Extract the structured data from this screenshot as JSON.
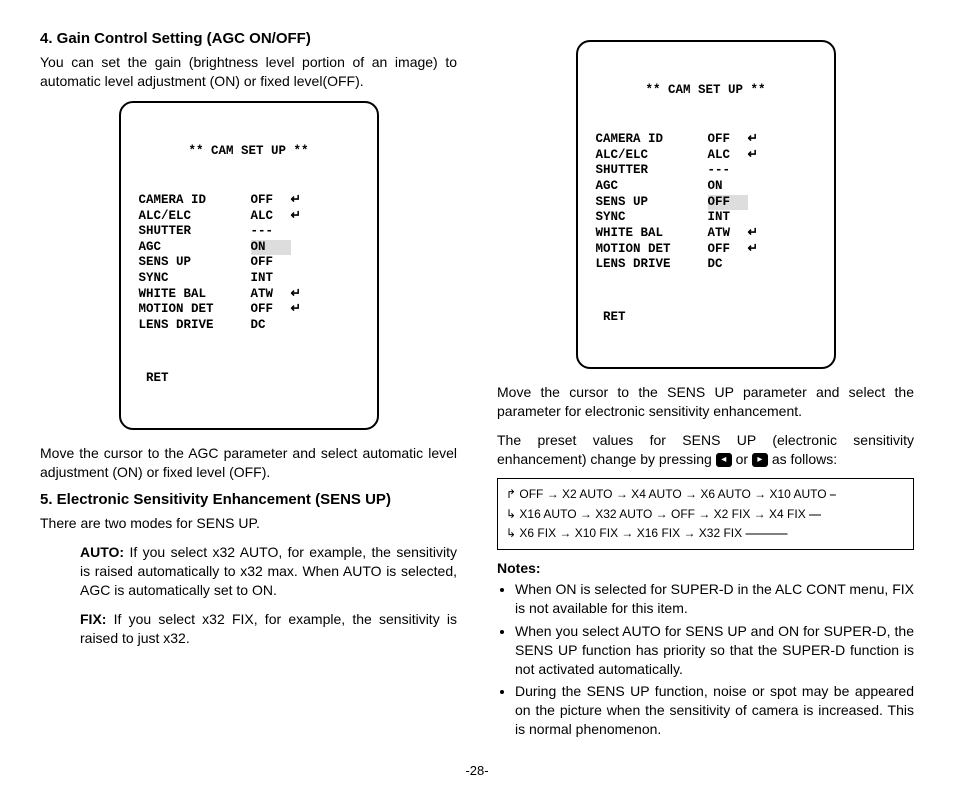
{
  "left": {
    "section4": {
      "heading": "4. Gain Control Setting (AGC ON/OFF)",
      "intro": "You can set the gain (brightness level portion of an image) to automatic level adjustment (ON) or fixed level(OFF).",
      "post": "Move the cursor to the AGC parameter and select automatic level adjustment (ON) or fixed level (OFF)."
    },
    "section5": {
      "heading": "5. Electronic Sensitivity Enhancement (SENS UP)",
      "intro": "There are two modes for SENS UP.",
      "auto_label": "AUTO:",
      "auto_text": "If you select x32 AUTO, for example, the sensitivity is raised automatically to x32 max. When AUTO is selected, AGC is automatically set to ON.",
      "fix_label": "FIX:",
      "fix_text": "If you select x32 FIX, for example, the sensitivity is raised to just x32."
    },
    "menu": {
      "title": "** CAM SET UP **",
      "rows": [
        {
          "label": "CAMERA ID",
          "val": "OFF",
          "mark": "↵"
        },
        {
          "label": "ALC/ELC",
          "val": "ALC",
          "mark": "↵"
        },
        {
          "label": "SHUTTER",
          "val": "---",
          "mark": ""
        },
        {
          "label": "AGC",
          "val": "ON",
          "mark": "",
          "hl": true
        },
        {
          "label": "SENS UP",
          "val": "OFF",
          "mark": ""
        },
        {
          "label": "SYNC",
          "val": "INT",
          "mark": ""
        },
        {
          "label": "WHITE BAL",
          "val": "ATW",
          "mark": "↵"
        },
        {
          "label": "MOTION DET",
          "val": "OFF",
          "mark": "↵"
        },
        {
          "label": "LENS DRIVE",
          "val": "DC",
          "mark": ""
        }
      ],
      "ret": "RET"
    }
  },
  "right": {
    "menu": {
      "title": "** CAM SET UP **",
      "rows": [
        {
          "label": "CAMERA ID",
          "val": "OFF",
          "mark": "↵"
        },
        {
          "label": "ALC/ELC",
          "val": "ALC",
          "mark": "↵"
        },
        {
          "label": "SHUTTER",
          "val": "---",
          "mark": ""
        },
        {
          "label": "AGC",
          "val": "ON",
          "mark": ""
        },
        {
          "label": "SENS UP",
          "val": "OFF",
          "mark": "",
          "hl": true
        },
        {
          "label": "SYNC",
          "val": "INT",
          "mark": ""
        },
        {
          "label": "WHITE BAL",
          "val": "ATW",
          "mark": "↵"
        },
        {
          "label": "MOTION DET",
          "val": "OFF",
          "mark": "↵"
        },
        {
          "label": "LENS DRIVE",
          "val": "DC",
          "mark": ""
        }
      ],
      "ret": "RET"
    },
    "para1": "Move the cursor to the SENS UP parameter and select the parameter for electronic sensitivity enhancement.",
    "para2_a": "The preset values for SENS UP (electronic sensitivity enhancement) change by pressing ",
    "para2_b": " or ",
    "para2_c": " as follows:",
    "flow": {
      "r1": "↱ OFF → X2 AUTO → X4 AUTO → X6 AUTO → X10 AUTO ⎯",
      "r2": "↳ X16 AUTO → X32 AUTO → OFF → X2 FIX → X4 FIX ⎯⎯",
      "r3": "↳ X6 FIX → X10 FIX → X16 FIX → X32 FIX ⎯⎯⎯⎯⎯⎯⎯"
    },
    "notes_heading": "Notes:",
    "notes": [
      "When ON is selected for SUPER-D in the ALC CONT menu, FIX is not available for this item.",
      "When you select AUTO for SENS UP and ON for SUPER-D, the SENS UP function has priority so that the SUPER-D function is not activated automatically.",
      "During the SENS UP function, noise or spot may be appeared on the picture when the sensitivity of camera is increased. This is normal phenomenon."
    ]
  },
  "page_num": "-28-"
}
